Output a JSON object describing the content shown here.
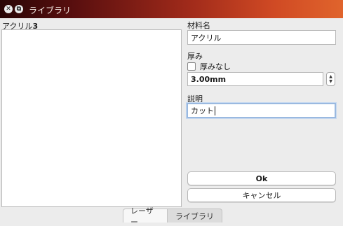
{
  "window": {
    "title": "ライブラリ",
    "close_icon_glyph": "✕",
    "restore_icon_glyph": "⧉"
  },
  "list": {
    "label_prefix": "アクリル",
    "label_number": "3",
    "items": []
  },
  "form": {
    "name_label": "材料名",
    "name_value": "アクリル",
    "thickness_label": "厚み",
    "no_thickness_label": "厚みなし",
    "no_thickness_checked": false,
    "thickness_value": "3.00mm",
    "description_label": "説明",
    "description_value": "カット"
  },
  "buttons": {
    "ok": "Ok",
    "cancel": "キャンセル"
  },
  "tabs": [
    {
      "label": "レーザー",
      "active": true
    },
    {
      "label": "ライブラリ",
      "active": false
    }
  ]
}
